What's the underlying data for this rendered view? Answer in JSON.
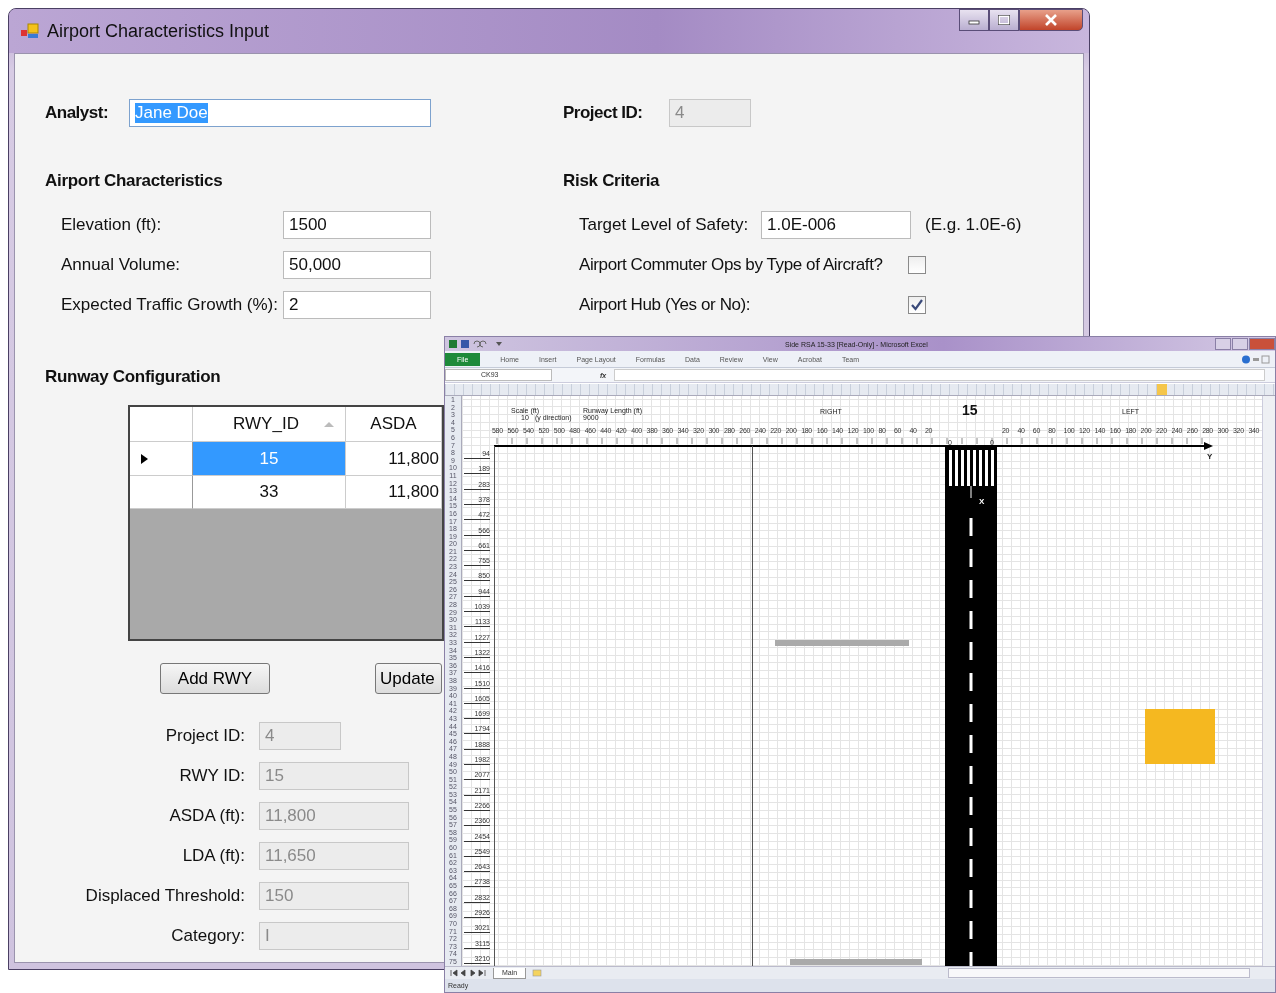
{
  "form_window": {
    "title": "Airport Characteristics Input",
    "analyst": {
      "label": "Analyst:",
      "value": "Jane Doe",
      "selected": true
    },
    "project_id": {
      "label": "Project ID:",
      "value": "4",
      "disabled": true
    },
    "airport_characteristics": {
      "heading": "Airport Characteristics",
      "fields": [
        {
          "label": "Elevation (ft):",
          "value": "1500"
        },
        {
          "label": "Annual Volume:",
          "value": "50,000"
        },
        {
          "label": "Expected Traffic Growth (%):",
          "value": "2"
        }
      ]
    },
    "risk_criteria": {
      "heading": "Risk Criteria",
      "items": [
        {
          "kind": "text",
          "label": "Target Level of Safety:",
          "value": "1.0E-006",
          "hint": "(E.g. 1.0E-6)"
        },
        {
          "kind": "checkbox",
          "label": "Airport Commuter Ops by Type of Aircraft?",
          "checked": false
        },
        {
          "kind": "checkbox",
          "label": "Airport Hub (Yes or No):",
          "checked": true
        }
      ]
    },
    "runway_configuration": {
      "heading": "Runway Configuration",
      "columns": [
        "RWY_ID",
        "ASDA"
      ],
      "rows": [
        {
          "selected": true,
          "cells": [
            "15",
            "11,800"
          ]
        },
        {
          "selected": false,
          "cells": [
            "33",
            "11,800"
          ]
        }
      ],
      "buttons": [
        "Add RWY",
        "Update"
      ]
    },
    "details": [
      {
        "kind": "short",
        "label": "Project ID:",
        "value": "4",
        "disabled": true
      },
      {
        "kind": "long",
        "label": "RWY ID:",
        "value": "15",
        "disabled": true
      },
      {
        "kind": "long",
        "label": "ASDA (ft):",
        "value": "11,800",
        "disabled": true
      },
      {
        "kind": "long",
        "label": "LDA (ft):",
        "value": "11,650",
        "disabled": true
      },
      {
        "kind": "long",
        "label": "Displaced Threshold:",
        "value": "150",
        "disabled": true
      },
      {
        "kind": "long",
        "label": "Category:",
        "value": "I",
        "disabled": true
      }
    ]
  },
  "excel_window": {
    "title": "Side RSA 15-33  [Read-Only]  -  Microsoft Excel",
    "ribbon_tabs": [
      {
        "label": "File",
        "selected": true
      },
      {
        "label": "Home",
        "selected": false
      },
      {
        "label": "Insert",
        "selected": false
      },
      {
        "label": "Page Layout",
        "selected": false
      },
      {
        "label": "Formulas",
        "selected": false
      },
      {
        "label": "Data",
        "selected": false
      },
      {
        "label": "Review",
        "selected": false
      },
      {
        "label": "View",
        "selected": false
      },
      {
        "label": "Acrobat",
        "selected": false
      },
      {
        "label": "Team",
        "selected": false
      }
    ],
    "name_box": "CK93",
    "formula_label": "fx",
    "row_numbers": [
      "1",
      "2",
      "3",
      "4",
      "5",
      "6",
      "7",
      "8",
      "9",
      "10",
      "11",
      "12",
      "13",
      "14",
      "15",
      "16",
      "17",
      "18",
      "19",
      "20",
      "21",
      "22",
      "23",
      "24",
      "25",
      "26",
      "27",
      "28",
      "29",
      "30",
      "31",
      "32",
      "33",
      "34",
      "35",
      "36",
      "37",
      "38",
      "39",
      "40",
      "41",
      "42",
      "43",
      "44",
      "45",
      "46",
      "47",
      "48",
      "49",
      "50",
      "51",
      "52",
      "53",
      "54",
      "55",
      "56",
      "57",
      "58",
      "59",
      "60",
      "61",
      "62",
      "63",
      "64",
      "65",
      "66",
      "67",
      "68",
      "69",
      "70",
      "71",
      "72",
      "73",
      "74",
      "75"
    ],
    "sheet": {
      "scale_label": "Scale (ft)",
      "scale_value": "10",
      "scale_direction": "(y direction)",
      "length_label": "Runway Length (ft)",
      "length_value": "9000",
      "right_label": "RIGHT",
      "runway_number": "15",
      "left_label": "LEFT",
      "x_axis_label": "X",
      "y_axis_label": "Y",
      "left_ticks": [
        "580",
        "560",
        "540",
        "520",
        "500",
        "480",
        "460",
        "440",
        "420",
        "400",
        "380",
        "360",
        "340",
        "320",
        "300",
        "280",
        "260",
        "240",
        "220",
        "200",
        "180",
        "160",
        "140",
        "120",
        "100",
        "80",
        "60",
        "40",
        "20"
      ],
      "edge_ticks": [
        "0",
        "0"
      ],
      "right_ticks": [
        "20",
        "40",
        "60",
        "80",
        "100",
        "120",
        "140",
        "160",
        "180",
        "200",
        "220",
        "240",
        "260",
        "280",
        "300",
        "320",
        "340"
      ],
      "distance_ticks": [
        "94",
        "189",
        "283",
        "378",
        "472",
        "566",
        "661",
        "755",
        "850",
        "944",
        "1039",
        "1133",
        "1227",
        "1322",
        "1416",
        "1510",
        "1605",
        "1699",
        "1794",
        "1888",
        "1982",
        "2077",
        "2171",
        "2266",
        "2360",
        "2454",
        "2549",
        "2643",
        "2738",
        "2832",
        "2926",
        "3021",
        "3115",
        "3210"
      ]
    },
    "sheet_tabs": [
      {
        "label": "Main"
      }
    ],
    "status": "Ready"
  }
}
